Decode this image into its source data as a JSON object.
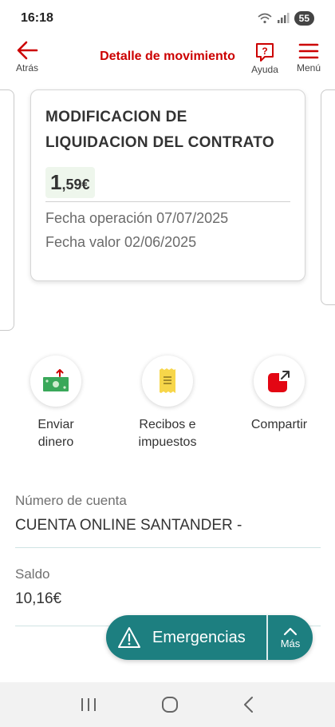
{
  "status_bar": {
    "time": "16:18",
    "icons": "wifi signal",
    "battery": "55"
  },
  "header": {
    "back_label": "Atrás",
    "title": "Detalle de movimiento",
    "help_label": "Ayuda",
    "menu_label": "Menú"
  },
  "movement": {
    "title_line1": "MODIFICACION DE",
    "title_line2": "LIQUIDACION DEL CONTRATO",
    "amount_integer": "1",
    "amount_decimal": ",59€",
    "operation_date": "Fecha operación 07/07/2025",
    "value_date": "Fecha valor 02/06/2025"
  },
  "actions": [
    {
      "line1": "Enviar",
      "line2": "dinero",
      "icon": "send-money-icon"
    },
    {
      "line1": "Recibos e",
      "line2": "impuestos",
      "icon": "receipt-icon"
    },
    {
      "line1": "Compartir",
      "line2": "",
      "icon": "share-icon"
    }
  ],
  "account": {
    "number_label": "Número de cuenta",
    "number_value": "CUENTA ONLINE SANTANDER -",
    "balance_label": "Saldo",
    "balance_value": "10,16€"
  },
  "emergency": {
    "label": "Emergencias",
    "more_label": "Más"
  },
  "colors": {
    "brand_red": "#cc0000",
    "teal": "#1d7f80",
    "amount_bg": "#eef6ec"
  }
}
